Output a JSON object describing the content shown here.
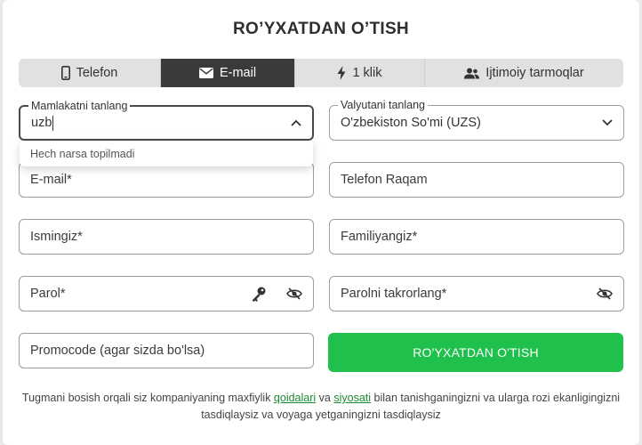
{
  "title": "RO’YXATDAN O’TISH",
  "tabs": [
    {
      "label": "Telefon",
      "icon": "phone-icon"
    },
    {
      "label": "E-mail",
      "icon": "envelope-icon",
      "active": true
    },
    {
      "label": "1 klik",
      "icon": "lightning-icon"
    },
    {
      "label": "Ijtimoiy tarmoqlar",
      "icon": "users-icon"
    }
  ],
  "country": {
    "label": "Mamlakatni tanlang",
    "value": "uzb",
    "no_results": "Hech narsa topilmadi"
  },
  "currency": {
    "label": "Valyutani tanlang",
    "value": "O'zbekiston So'mi (UZS)"
  },
  "fields": {
    "email": "E-mail*",
    "phone": "Telefon Raqam",
    "first_name": "Ismingiz*",
    "last_name": "Familiyangiz*",
    "password": "Parol*",
    "password_repeat": "Parolni takrorlang*",
    "promocode": "Promocode (agar sizda bo'lsa)"
  },
  "submit_label": "RO'YXATDAN O'TISH",
  "terms": {
    "part1": "Tugmani bosish orqali siz kompaniyaning maxfiylik ",
    "link1": "qoidalari",
    "part2": " va ",
    "link2": "siyosati",
    "part3": " bilan tanishganingizni va ularga rozi ekanligingizni tasdiqlaysiz va voyaga yetganingizni tasdiqlaysiz"
  }
}
